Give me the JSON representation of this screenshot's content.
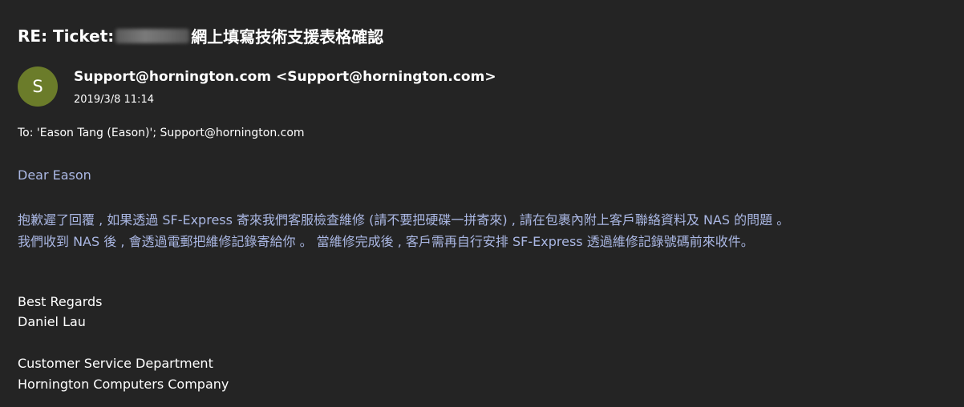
{
  "email": {
    "subject_prefix": "RE: Ticket:",
    "subject_suffix": "網上填寫技術支援表格確認",
    "sender_avatar_letter": "S",
    "sender": "Support@hornington.com <Support@hornington.com>",
    "date": "2019/3/8 11:14",
    "to_line": "To: 'Eason Tang (Eason)'; Support@hornington.com",
    "greeting": "Dear Eason",
    "body_lines": [
      "抱歉遲了回覆 , 如果透過 SF-Express 寄來我們客服檢查維修 (請不要把硬碟一拼寄來) , 請在包裹內附上客戶聯絡資料及 NAS 的問題 。",
      "我們收到 NAS 後 , 會透過電郵把維修記錄寄給你 。 當維修完成後 , 客戶需再自行安排 SF-Express 透過維修記錄號碼前來收件。"
    ],
    "signature": [
      "Best Regards",
      "Daniel Lau",
      "Customer Service Department",
      "Hornington Computers Company"
    ]
  },
  "colors": {
    "background": "#242424",
    "avatar": "#6b7c2a",
    "body_text": "#aab7e3"
  }
}
